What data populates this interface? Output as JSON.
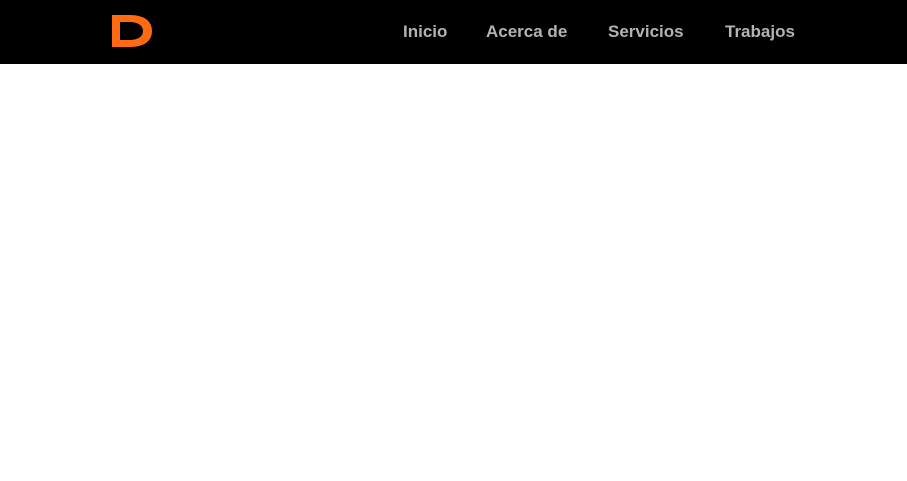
{
  "header": {
    "logo": {
      "letter": "D",
      "icon": "d-logo-icon",
      "color": "#ff6a13"
    },
    "background_color": "#000000",
    "nav_color": "#b3b3b3",
    "nav": [
      {
        "label": "Inicio"
      },
      {
        "label": "Acerca de"
      },
      {
        "label": "Servicios"
      },
      {
        "label": "Trabajos"
      }
    ]
  }
}
